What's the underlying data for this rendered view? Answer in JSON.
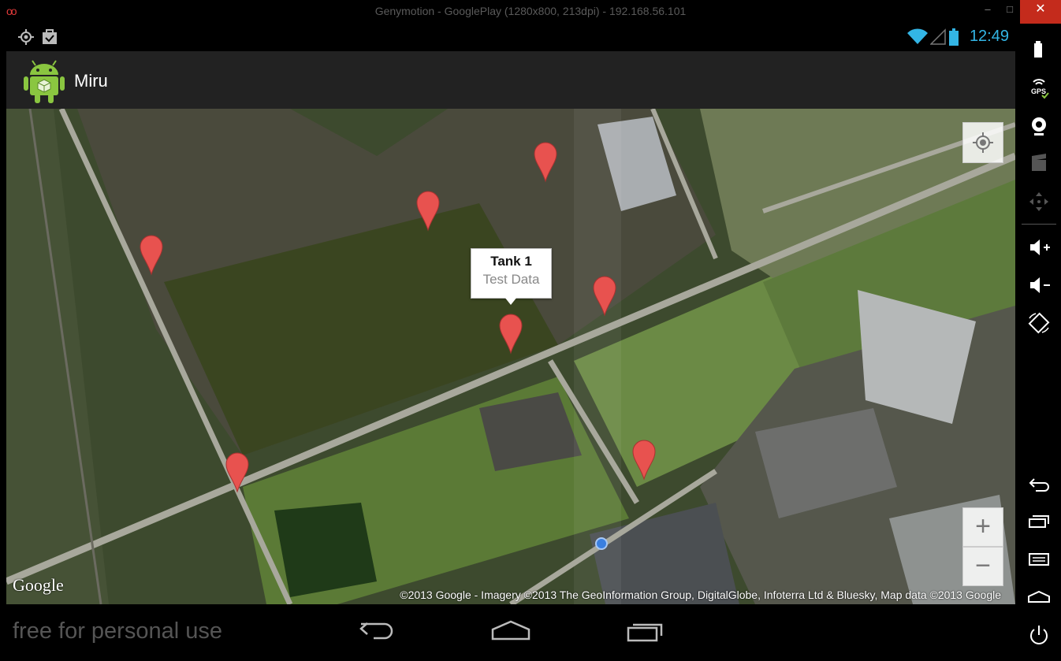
{
  "window": {
    "title": "Genymotion - GooglePlay (1280x800, 213dpi) - 192.168.56.101",
    "minimize": "–",
    "maximize": "□",
    "close": "✕"
  },
  "status_bar": {
    "left_icons": [
      "gps-icon",
      "clipboard-check-icon"
    ],
    "right_icons": [
      "wifi-icon",
      "signal-icon",
      "battery-icon"
    ],
    "time": "12:49",
    "accent_color": "#33b5e5"
  },
  "action_bar": {
    "app_icon": "android-robot-icon",
    "title": "Miru"
  },
  "map": {
    "markers": [
      "marker-1",
      "marker-2",
      "marker-3",
      "marker-4",
      "marker-5",
      "marker-6",
      "marker-7"
    ],
    "info_window": {
      "title": "Tank 1",
      "snippet": "Test Data"
    },
    "controls": {
      "my_location": "my-location-icon",
      "zoom_in": "+",
      "zoom_out": "−"
    },
    "logo": "Google",
    "attribution": "©2013 Google - Imagery ©2013 The GeoInformation Group, DigitalGlobe, Infoterra Ltd & Bluesky, Map data ©2013 Google",
    "marker_color": "#e8524f"
  },
  "nav_bar": {
    "watermark": "free for personal use",
    "buttons": [
      "back-icon",
      "home-icon",
      "recent-apps-icon"
    ]
  },
  "side_panel": {
    "buttons": [
      "battery-icon",
      "gps-icon",
      "camera-icon",
      "video-icon",
      "dpad-icon",
      "volume-up-icon",
      "volume-down-icon",
      "rotate-icon",
      "back-icon",
      "recent-apps-icon",
      "menu-icon",
      "home-icon",
      "power-icon"
    ]
  }
}
